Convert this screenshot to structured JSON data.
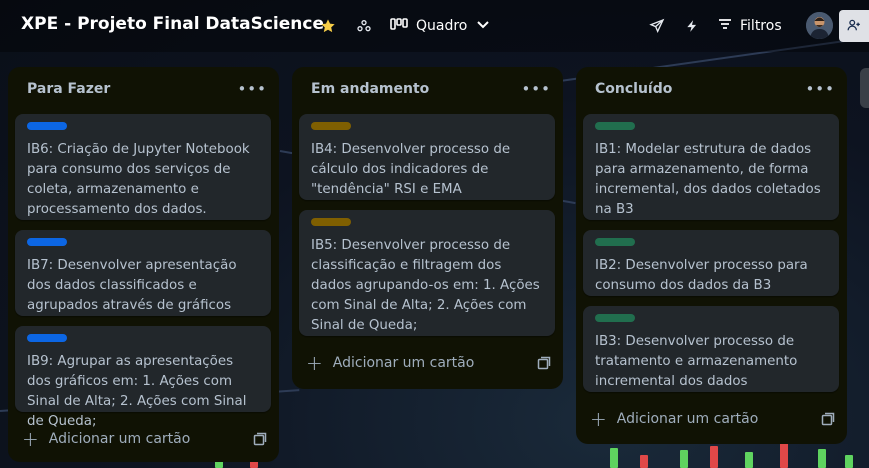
{
  "header": {
    "board_title": "XPE - Projeto Final DataScience",
    "view_label": "Quadro",
    "filters_label": "Filtros",
    "icons": [
      "star-icon",
      "workspace-icon",
      "board-view-icon",
      "chevron-down-icon",
      "send-icon",
      "lightning-icon",
      "filter-icon",
      "avatar",
      "add-member-icon"
    ],
    "star_color": "#f5cd47"
  },
  "lists": [
    {
      "title": "Para Fazer",
      "add_label": "Adicionar um cartão",
      "cards": [
        {
          "label_color": "#0c66e4",
          "text": "IB6: Criação de Jupyter Notebook para consumo dos serviços de coleta, armazenamento e processamento dos dados."
        },
        {
          "label_color": "#0c66e4",
          "text": "IB7: Desenvolver apresentação dos dados classificados e agrupados através de gráficos"
        },
        {
          "label_color": "#0c66e4",
          "text": "IB9: Agrupar as apresentações dos gráficos em: 1. Ações com Sinal de Alta; 2. Ações com Sinal de Queda;"
        }
      ]
    },
    {
      "title": "Em andamento",
      "add_label": "Adicionar um cartão",
      "cards": [
        {
          "label_color": "#7f5f01",
          "text": "IB4: Desenvolver processo de cálculo dos indicadores de \"tendência\" RSI e EMA"
        },
        {
          "label_color": "#7f5f01",
          "text": "IB5: Desenvolver processo de classificação e filtragem dos dados agrupando-os em: 1. Ações com Sinal de Alta; 2. Ações com Sinal de Queda;"
        }
      ]
    },
    {
      "title": "Concluído",
      "add_label": "Adicionar um cartão",
      "cards": [
        {
          "label_color": "#216e4e",
          "text": "IB1: Modelar estrutura de dados para armazenamento, de forma incremental, dos dados coletados na B3"
        },
        {
          "label_color": "#216e4e",
          "text": "IB2: Desenvolver processo para consumo dos dados da B3"
        },
        {
          "label_color": "#216e4e",
          "text": "IB3: Desenvolver processo de tratamento e armazenamento incremental dos dados"
        }
      ]
    }
  ]
}
